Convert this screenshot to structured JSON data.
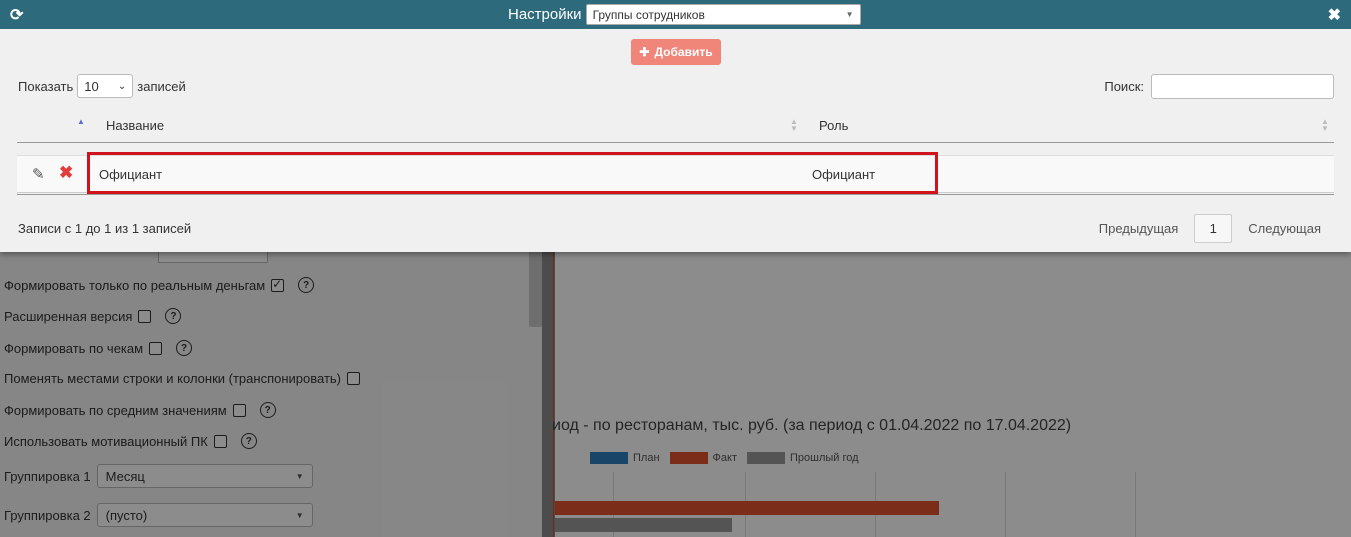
{
  "modal": {
    "title": "Настройки",
    "group_select": {
      "value": "Группы сотрудников"
    },
    "add_label": "Добавить",
    "show_label": "Показать",
    "page_length": "10",
    "records_label": "записей",
    "search_label": "Поиск:",
    "search_value": "",
    "columns": [
      {
        "label": "Название"
      },
      {
        "label": "Роль"
      }
    ],
    "rows": [
      {
        "name": "Официант",
        "role": "Официант"
      }
    ],
    "info": "Записи с 1 до 1 из 1 записей",
    "pagination": {
      "prev": "Предыдущая",
      "page": "1",
      "next": "Следующая"
    }
  },
  "background": {
    "options": [
      {
        "label": "Формировать только по реальным деньгам",
        "checked": true,
        "help": true
      },
      {
        "label": "Расширенная версия",
        "checked": false,
        "help": true
      },
      {
        "label": "Формировать по чекам",
        "checked": false,
        "help": true
      },
      {
        "label": "Поменять местами строки и колонки (транспонировать)",
        "checked": false,
        "help": false
      },
      {
        "label": "Формировать по средним значениям",
        "checked": false,
        "help": true
      },
      {
        "label": "Использовать мотивационный ПК",
        "checked": false,
        "help": true
      }
    ],
    "grouping": [
      {
        "label": "Группировка 1",
        "value": "Месяц"
      },
      {
        "label": "Группировка 2",
        "value": "(пусто)"
      }
    ],
    "chart_title": "иод - по ресторанам, тыс. руб. (за период с 01.04.2022 по 17.04.2022)",
    "legend": [
      {
        "name": "План",
        "color": "#2f7fbf"
      },
      {
        "name": "Факт",
        "color": "#e0532e"
      },
      {
        "name": "Прошлый год",
        "color": "#9a9a9a"
      }
    ]
  }
}
